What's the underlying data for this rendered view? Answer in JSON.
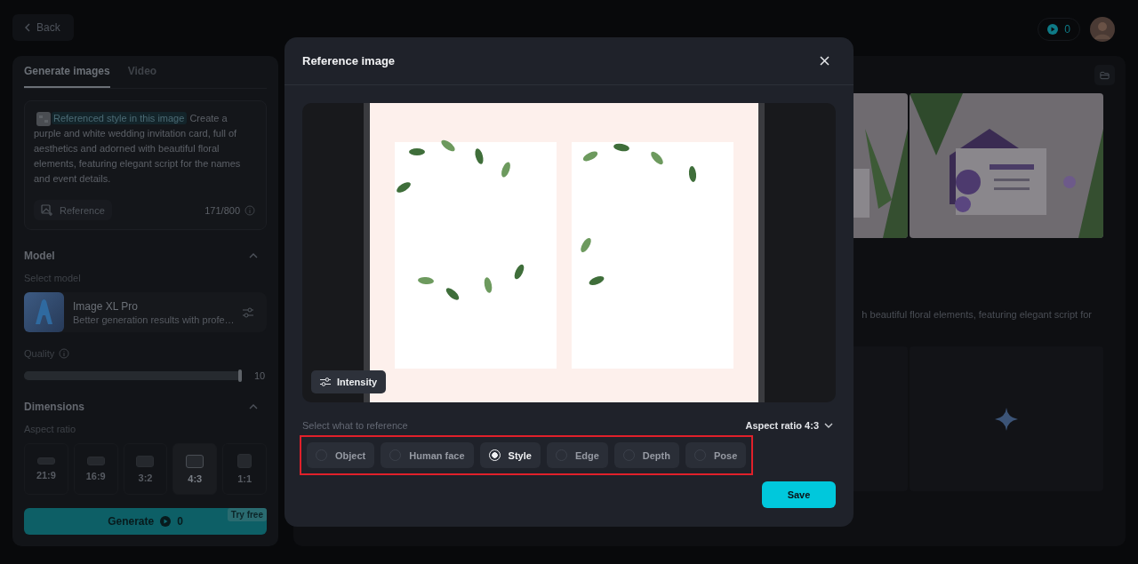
{
  "top_bar": {
    "back_button": "Back",
    "credits": "0"
  },
  "left_panel": {
    "tabs": [
      {
        "label": "Generate images",
        "selected": true
      },
      {
        "label": "Video",
        "selected": false
      }
    ],
    "prompt": {
      "reference_tag": "Referenced style in this image",
      "text": "Create a purple and white wedding invitation card, full of aesthetics and adorned with beautiful floral elements, featuring elegant script for the names and event details.",
      "reference_button": "Reference",
      "counter": "171/800"
    },
    "model": {
      "heading": "Model",
      "expanded": true,
      "label": "Select model",
      "name": "Image XL Pro",
      "description": "Better generation results with profe…"
    },
    "quality": {
      "label": "Quality",
      "level": 1,
      "reading": "10"
    },
    "dimensions": {
      "heading": "Dimensions",
      "expanded": true,
      "label": "Aspect ratio",
      "ratios": [
        {
          "label": "21:9",
          "selected": false
        },
        {
          "label": "16:9",
          "selected": false
        },
        {
          "label": "3:2",
          "selected": false
        },
        {
          "label": "4:3",
          "selected": true
        },
        {
          "label": "1:1",
          "selected": false
        }
      ]
    },
    "generate_button": {
      "label": "Generate",
      "cost": "0",
      "badge": "Try free"
    }
  },
  "results": {
    "prompt_fragment": "h beautiful floral elements, featuring elegant script for",
    "placeholders": [
      {
        "kind": "blank"
      },
      {
        "kind": "sparkle"
      }
    ]
  },
  "dialog": {
    "title": "Reference image",
    "intensity_button": "Intensity",
    "select_label": "Select what to reference",
    "aspect_ratio": "Aspect ratio 4:3",
    "options": [
      {
        "label": "Object",
        "selected": false
      },
      {
        "label": "Human face",
        "selected": false
      },
      {
        "label": "Style",
        "selected": true
      },
      {
        "label": "Edge",
        "selected": false
      },
      {
        "label": "Depth",
        "selected": false
      },
      {
        "label": "Pose",
        "selected": false
      }
    ],
    "save_button": "Save"
  }
}
